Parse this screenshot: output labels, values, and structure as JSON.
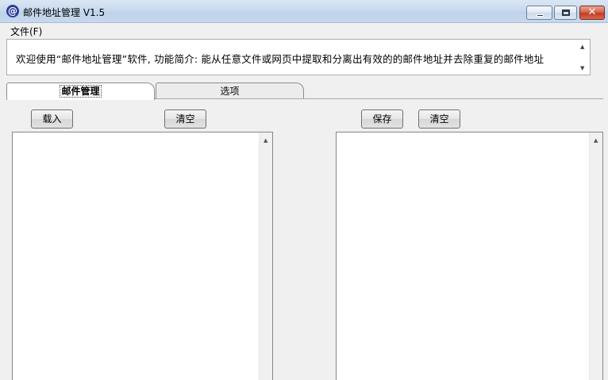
{
  "window": {
    "title": "邮件地址管理 V1.5",
    "app_icon": "@",
    "close_glyph": "✕",
    "accent": "#c23c24"
  },
  "menu": {
    "items": [
      {
        "label": "文件(F)"
      }
    ]
  },
  "info": {
    "text": "欢迎使用“邮件地址管理”软件, 功能简介: 能从任意文件或网页中提取和分离出有效的的邮件地址并去除重复的邮件地址",
    "scroll_up": "▲",
    "scroll_down": "▼"
  },
  "tabs": [
    {
      "label": "邮件管理",
      "active": true
    },
    {
      "label": "选项",
      "active": false
    }
  ],
  "left_panel": {
    "load_label": "载入",
    "clear_label": "清空",
    "scroll_up": "▲"
  },
  "right_panel": {
    "save_label": "保存",
    "clear_label": "清空",
    "scroll_up": "▲"
  }
}
